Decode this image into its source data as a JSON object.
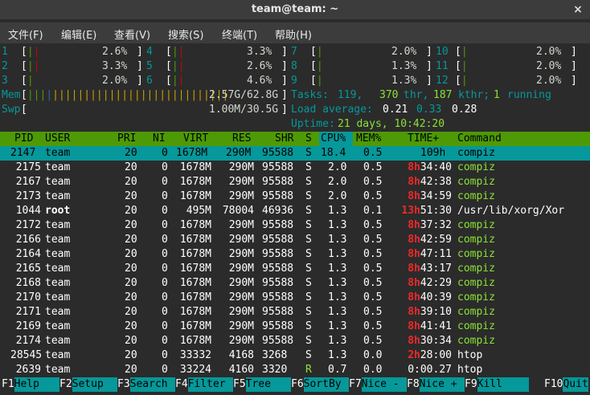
{
  "window": {
    "title": "team@team: ~",
    "close": "×"
  },
  "menu": [
    "文件(F)",
    "编辑(E)",
    "查看(V)",
    "搜索(S)",
    "终端(T)",
    "帮助(H)"
  ],
  "cpus": [
    {
      "id": "1",
      "pct": "2.6%"
    },
    {
      "id": "2",
      "pct": "3.3%"
    },
    {
      "id": "3",
      "pct": "2.0%"
    },
    {
      "id": "4",
      "pct": "3.3%"
    },
    {
      "id": "5",
      "pct": "2.6%"
    },
    {
      "id": "6",
      "pct": "4.6%"
    },
    {
      "id": "7",
      "pct": "2.0%"
    },
    {
      "id": "8",
      "pct": "1.3%"
    },
    {
      "id": "9",
      "pct": "1.3%"
    },
    {
      "id": "10",
      "pct": "2.0%"
    },
    {
      "id": "11",
      "pct": "2.0%"
    },
    {
      "id": "12",
      "pct": "2.0%"
    }
  ],
  "mem": {
    "label": "Mem",
    "value": "2.57G/62.8G"
  },
  "swp": {
    "label": "Swp",
    "value": "1.00M/30.5G"
  },
  "tasks": {
    "label": "Tasks:",
    "count": "119,",
    "thr": "370",
    "thr_label": "thr,",
    "kthr": "187",
    "kthr_label": "kthr;",
    "running": "1",
    "running_label": "running"
  },
  "load": {
    "label": "Load average:",
    "a": "0.21",
    "b": "0.33",
    "c": "0.28"
  },
  "uptime": {
    "label": "Uptime:",
    "value": "21 days, 10:42:20"
  },
  "columns": [
    "PID",
    "USER",
    "PRI",
    "NI",
    "VIRT",
    "RES",
    "SHR",
    "S",
    "CPU%",
    "MEM%",
    "TIME+",
    "Command"
  ],
  "processes": [
    {
      "pid": "2147",
      "user": "team",
      "pri": "20",
      "ni": "0",
      "virt": "1678M",
      "res": "290M",
      "shr": "95588",
      "s": "S",
      "cpu": "18.4",
      "mem": "0.5",
      "time_h": "",
      "time_r": "109h",
      "cmd": "compiz"
    },
    {
      "pid": "2175",
      "user": "team",
      "pri": "20",
      "ni": "0",
      "virt": "1678M",
      "res": "290M",
      "shr": "95588",
      "s": "S",
      "cpu": "2.0",
      "mem": "0.5",
      "time_h": "8h",
      "time_r": "34:40",
      "cmd": "compiz"
    },
    {
      "pid": "2167",
      "user": "team",
      "pri": "20",
      "ni": "0",
      "virt": "1678M",
      "res": "290M",
      "shr": "95588",
      "s": "S",
      "cpu": "2.0",
      "mem": "0.5",
      "time_h": "8h",
      "time_r": "42:38",
      "cmd": "compiz"
    },
    {
      "pid": "2173",
      "user": "team",
      "pri": "20",
      "ni": "0",
      "virt": "1678M",
      "res": "290M",
      "shr": "95588",
      "s": "S",
      "cpu": "2.0",
      "mem": "0.5",
      "time_h": "8h",
      "time_r": "34:59",
      "cmd": "compiz"
    },
    {
      "pid": "1044",
      "user": "root",
      "pri": "20",
      "ni": "0",
      "virt": "495M",
      "res": "78004",
      "shr": "46936",
      "s": "S",
      "cpu": "1.3",
      "mem": "0.1",
      "time_h": "13h",
      "time_r": "51:30",
      "cmd": "/usr/lib/xorg/Xor"
    },
    {
      "pid": "2172",
      "user": "team",
      "pri": "20",
      "ni": "0",
      "virt": "1678M",
      "res": "290M",
      "shr": "95588",
      "s": "S",
      "cpu": "1.3",
      "mem": "0.5",
      "time_h": "8h",
      "time_r": "37:32",
      "cmd": "compiz"
    },
    {
      "pid": "2166",
      "user": "team",
      "pri": "20",
      "ni": "0",
      "virt": "1678M",
      "res": "290M",
      "shr": "95588",
      "s": "S",
      "cpu": "1.3",
      "mem": "0.5",
      "time_h": "8h",
      "time_r": "42:59",
      "cmd": "compiz"
    },
    {
      "pid": "2164",
      "user": "team",
      "pri": "20",
      "ni": "0",
      "virt": "1678M",
      "res": "290M",
      "shr": "95588",
      "s": "S",
      "cpu": "1.3",
      "mem": "0.5",
      "time_h": "8h",
      "time_r": "47:11",
      "cmd": "compiz"
    },
    {
      "pid": "2165",
      "user": "team",
      "pri": "20",
      "ni": "0",
      "virt": "1678M",
      "res": "290M",
      "shr": "95588",
      "s": "S",
      "cpu": "1.3",
      "mem": "0.5",
      "time_h": "8h",
      "time_r": "43:17",
      "cmd": "compiz"
    },
    {
      "pid": "2168",
      "user": "team",
      "pri": "20",
      "ni": "0",
      "virt": "1678M",
      "res": "290M",
      "shr": "95588",
      "s": "S",
      "cpu": "1.3",
      "mem": "0.5",
      "time_h": "8h",
      "time_r": "42:29",
      "cmd": "compiz"
    },
    {
      "pid": "2170",
      "user": "team",
      "pri": "20",
      "ni": "0",
      "virt": "1678M",
      "res": "290M",
      "shr": "95588",
      "s": "S",
      "cpu": "1.3",
      "mem": "0.5",
      "time_h": "8h",
      "time_r": "40:39",
      "cmd": "compiz"
    },
    {
      "pid": "2171",
      "user": "team",
      "pri": "20",
      "ni": "0",
      "virt": "1678M",
      "res": "290M",
      "shr": "95588",
      "s": "S",
      "cpu": "1.3",
      "mem": "0.5",
      "time_h": "8h",
      "time_r": "39:10",
      "cmd": "compiz"
    },
    {
      "pid": "2169",
      "user": "team",
      "pri": "20",
      "ni": "0",
      "virt": "1678M",
      "res": "290M",
      "shr": "95588",
      "s": "S",
      "cpu": "1.3",
      "mem": "0.5",
      "time_h": "8h",
      "time_r": "41:41",
      "cmd": "compiz"
    },
    {
      "pid": "2174",
      "user": "team",
      "pri": "20",
      "ni": "0",
      "virt": "1678M",
      "res": "290M",
      "shr": "95588",
      "s": "S",
      "cpu": "1.3",
      "mem": "0.5",
      "time_h": "8h",
      "time_r": "30:34",
      "cmd": "compiz"
    },
    {
      "pid": "28545",
      "user": "team",
      "pri": "20",
      "ni": "0",
      "virt": "33332",
      "res": "4168",
      "shr": "3268",
      "s": "S",
      "cpu": "1.3",
      "mem": "0.0",
      "time_h": "2h",
      "time_r": "28:00",
      "cmd": "htop"
    },
    {
      "pid": "2639",
      "user": "team",
      "pri": "20",
      "ni": "0",
      "virt": "33224",
      "res": "4160",
      "shr": "3320",
      "s": "R",
      "cpu": "0.7",
      "mem": "0.0",
      "time_h": "",
      "time_r": "0:00.27",
      "cmd": "htop"
    }
  ],
  "fkeys": [
    {
      "key": "F1",
      "label": "Help"
    },
    {
      "key": "F2",
      "label": "Setup"
    },
    {
      "key": "F3",
      "label": "Search"
    },
    {
      "key": "F4",
      "label": "Filter"
    },
    {
      "key": "F5",
      "label": "Tree"
    },
    {
      "key": "F6",
      "label": "SortBy"
    },
    {
      "key": "F7",
      "label": "Nice -"
    },
    {
      "key": "F8",
      "label": "Nice +"
    },
    {
      "key": "F9",
      "label": "Kill"
    },
    {
      "key": "F10",
      "label": "Quit"
    }
  ],
  "colors": {
    "header_bg": "#4e9a06",
    "selected_bg": "#06989a",
    "bar_green": "#4e9a06",
    "bar_red": "#cc0000",
    "bar_yellow": "#c4a000"
  }
}
